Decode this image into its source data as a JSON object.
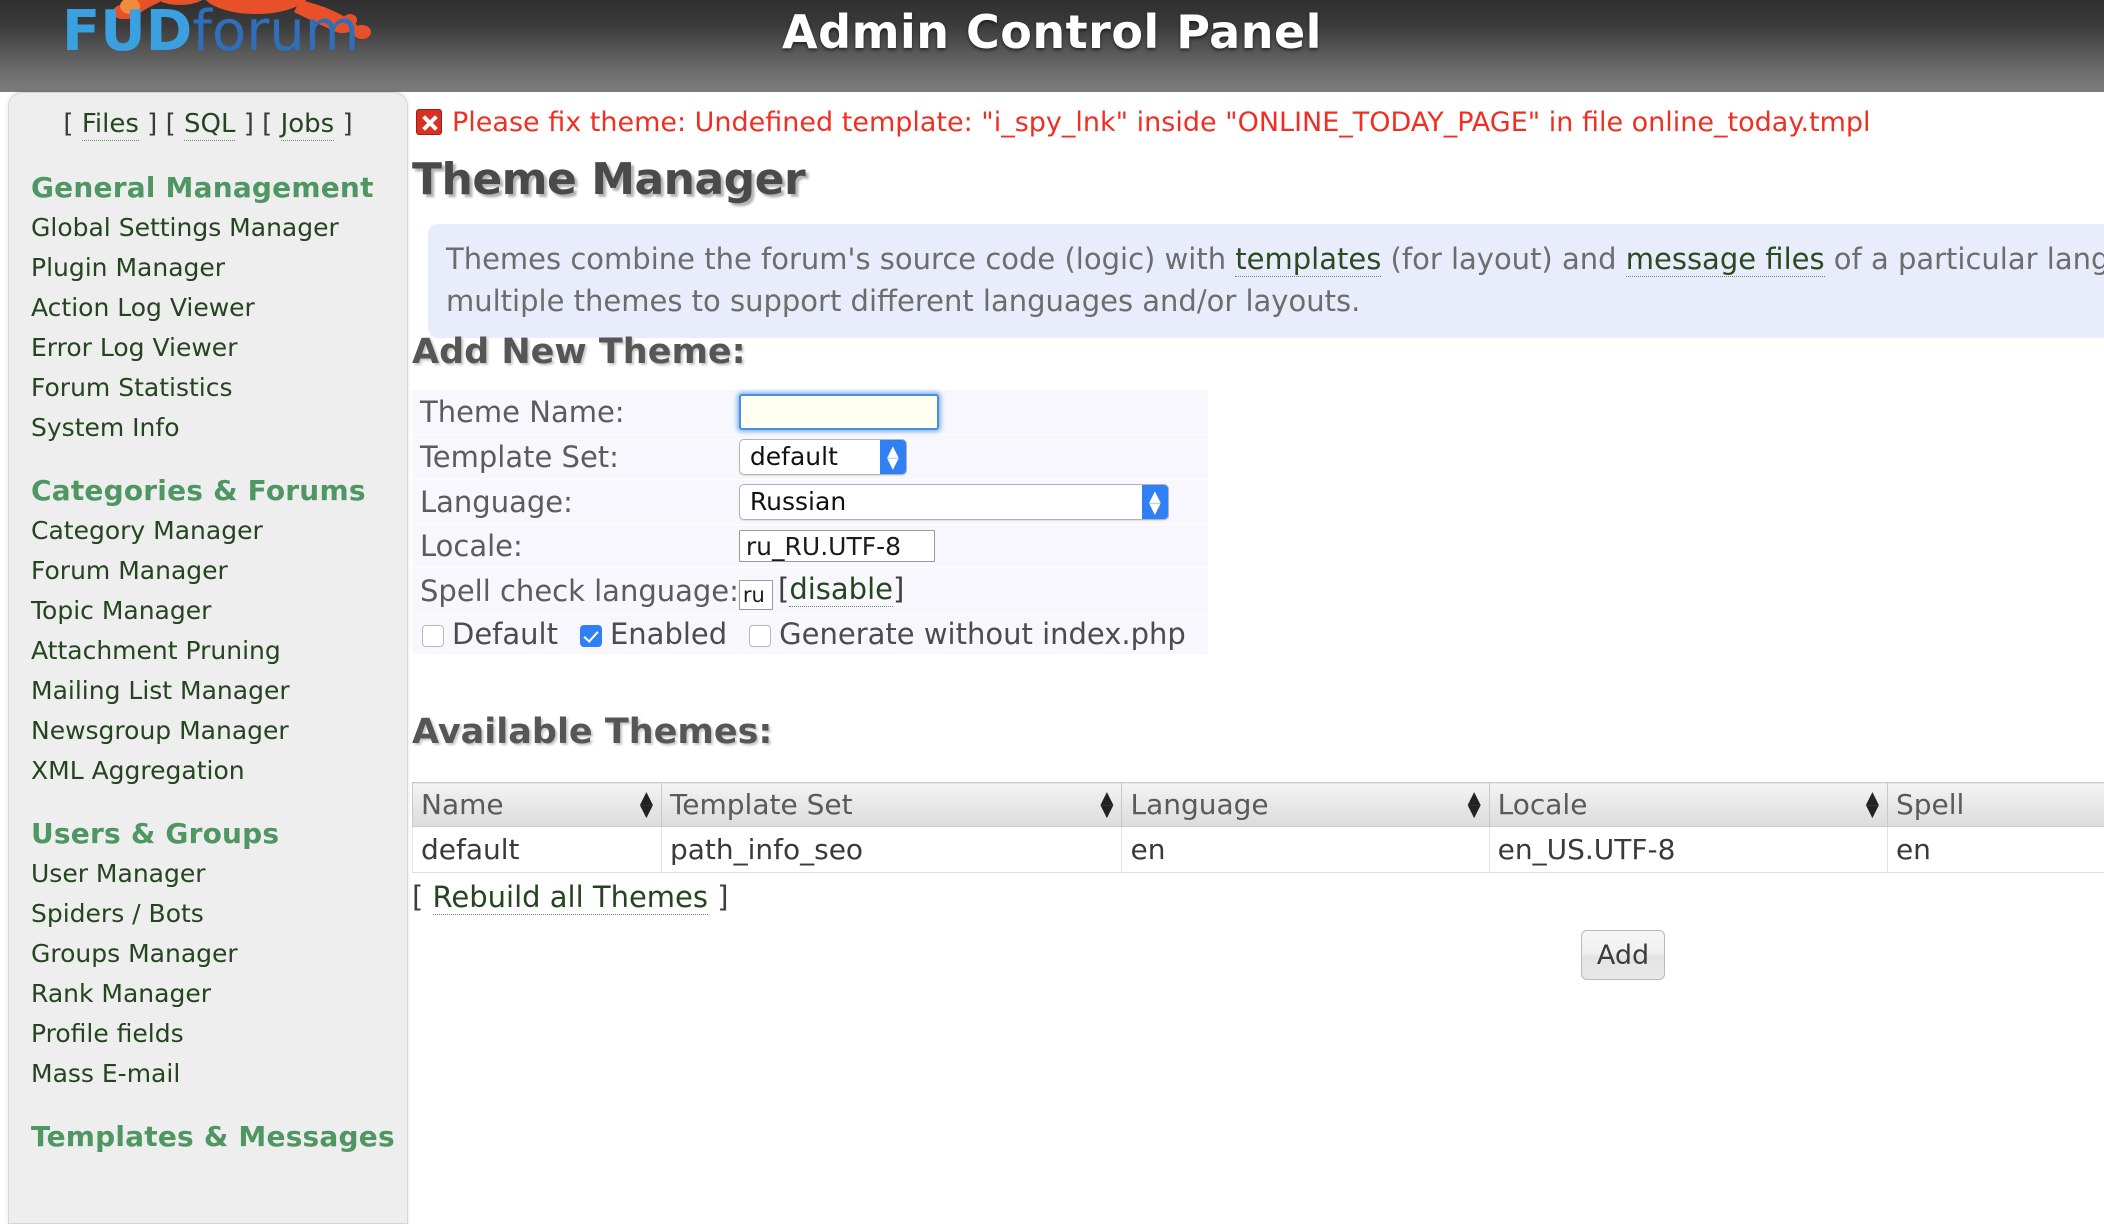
{
  "banner": {
    "title": "Admin Control Panel",
    "logo_primary": "FUD",
    "logo_secondary": "forum"
  },
  "sidebar": {
    "shortcuts": [
      {
        "label": "Files"
      },
      {
        "label": "SQL"
      },
      {
        "label": "Jobs"
      }
    ],
    "groups": [
      {
        "heading": "General Management",
        "items": [
          {
            "label": "Global Settings Manager"
          },
          {
            "label": "Plugin Manager"
          },
          {
            "label": "Action Log Viewer"
          },
          {
            "label": "Error Log Viewer"
          },
          {
            "label": "Forum Statistics"
          },
          {
            "label": "System Info"
          }
        ]
      },
      {
        "heading": "Categories & Forums",
        "items": [
          {
            "label": "Category Manager"
          },
          {
            "label": "Forum Manager"
          },
          {
            "label": "Topic Manager"
          },
          {
            "label": "Attachment Pruning"
          },
          {
            "label": "Mailing List Manager"
          },
          {
            "label": "Newsgroup Manager"
          },
          {
            "label": "XML Aggregation"
          }
        ]
      },
      {
        "heading": "Users & Groups",
        "items": [
          {
            "label": "User Manager"
          },
          {
            "label": "Spiders / Bots"
          },
          {
            "label": "Groups Manager"
          },
          {
            "label": "Rank Manager"
          },
          {
            "label": "Profile fields"
          },
          {
            "label": "Mass E-mail"
          }
        ]
      },
      {
        "heading": "Templates & Messages",
        "items": []
      }
    ]
  },
  "error": {
    "icon": "error-x-icon",
    "message": "Please fix theme: Undefined template: \"i_spy_lnk\" inside \"ONLINE_TODAY_PAGE\" in file online_today.tmpl",
    "color": "#f02f22"
  },
  "main": {
    "heading": "Theme Manager",
    "intro": {
      "line1_a": "Themes combine the forum's source code (logic) with ",
      "link_templates": "templates",
      "line1_b": " (for layout) and ",
      "link_message_files": "message files",
      "line1_c": " of a particular language. A forum can have",
      "line2": "multiple themes to support different languages and/or layouts."
    },
    "add_section_title": "Add New Theme:",
    "form": {
      "theme_name_label": "Theme Name:",
      "theme_name_value": "",
      "template_set_label": "Template Set:",
      "template_set_value": "default",
      "language_label": "Language:",
      "language_value": "Russian",
      "locale_label": "Locale:",
      "locale_value": "ru_RU.UTF-8",
      "spell_label": "Spell check language:",
      "spell_value": "ru",
      "spell_disable_link": "disable",
      "bracket_open": "[",
      "bracket_close": "]",
      "checkbox_default_label": "Default",
      "checkbox_default_checked": false,
      "checkbox_enabled_label": "Enabled",
      "checkbox_enabled_checked": true,
      "checkbox_noindex_label": "Generate without index.php",
      "checkbox_noindex_checked": false,
      "add_button": "Add"
    },
    "available_section_title": "Available Themes:",
    "table": {
      "columns": [
        "Name",
        "Template Set",
        "Language",
        "Locale",
        "Spell"
      ],
      "sort_icon": "sort-arrows-icon",
      "rows": [
        {
          "name": "default",
          "template_set": "path_info_seo",
          "language": "en",
          "locale": "en_US.UTF-8",
          "spell": "en"
        }
      ]
    },
    "rebuild": {
      "bracket_open": "[",
      "label": "Rebuild all Themes",
      "bracket_close": "]"
    }
  }
}
